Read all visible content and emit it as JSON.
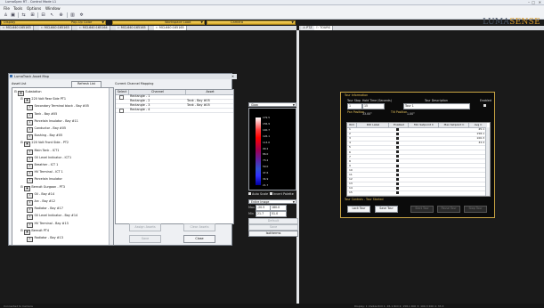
{
  "app": {
    "title": "LumaSpec RT - Control Mode L1",
    "window_controls": [
      "–",
      "□",
      "✕"
    ],
    "logo_main": "LUMA",
    "logo_accent": "SENSE",
    "logo_sub": "TECHNOLOGIES"
  },
  "menu": [
    "File",
    "Tools",
    "Options",
    "Window"
  ],
  "toolbar_icons": [
    "user-icon",
    "monitor-icon",
    "arrows-icon",
    "compare-icon",
    "grid-icon",
    "cursor-icon",
    "zoom-icon",
    "layout-icon",
    "settings-icon"
  ],
  "status_bars": {
    "left": {
      "label": "Display",
      "value": "Pop-Up Color"
    },
    "middle": {
      "label": "Workspace Load",
      "value": "Camera"
    }
  },
  "doc_tabs": [
    "MCL640:165163",
    "MCL640:165163",
    "MCL640:165164",
    "MCL640:165165",
    "MCL640:165165"
  ],
  "view_tabs": [
    "PTZ",
    "TOURS"
  ],
  "dialog": {
    "title": "LumaTrack Asset Map",
    "asset_list_label": "Asset List",
    "refresh_label": "Refresh List",
    "channel_mapping_label": "Current Channel Mapping",
    "tree": [
      {
        "level": 0,
        "label": "Substation"
      },
      {
        "level": 1,
        "label": "220 Volt Rear Side PT1"
      },
      {
        "level": 2,
        "label": "Secondary Terminal block - Bay #05"
      },
      {
        "level": 2,
        "label": "Tank - Bay #05"
      },
      {
        "level": 2,
        "label": "Porcelain Insulator - Bay #11"
      },
      {
        "level": 2,
        "label": "Conductor - Bay #05"
      },
      {
        "level": 2,
        "label": "Bushing - Bay #05"
      },
      {
        "level": 1,
        "label": "220 Volt Front Side - PT2"
      },
      {
        "level": 2,
        "label": "Main Tank - ICT1"
      },
      {
        "level": 2,
        "label": "Oil Level Indicator - ICT1"
      },
      {
        "level": 2,
        "label": "Breather - ICT 1"
      },
      {
        "level": 2,
        "label": "HV Terminal - ICT 1"
      },
      {
        "level": 2,
        "label": "Porcelain Insulator"
      },
      {
        "level": 1,
        "label": "Bernoit Gurgaon - PT3"
      },
      {
        "level": 2,
        "label": "Oil - Bay #14"
      },
      {
        "level": 2,
        "label": "Arc - Bay #12"
      },
      {
        "level": 2,
        "label": "Radiator - Bay #17"
      },
      {
        "level": 2,
        "label": "Oil Level Indicator - Bay #14"
      },
      {
        "level": 2,
        "label": "HV Terminal - Bay #13"
      },
      {
        "level": 1,
        "label": "Bernoit PT4"
      },
      {
        "level": 2,
        "label": "Radiator - Bay #13"
      }
    ],
    "grid_headers": [
      "Select",
      "Channel",
      "Asset"
    ],
    "grid_rows": [
      {
        "channel": "Rectangle - 1",
        "asset": ""
      },
      {
        "channel": "Rectangle - 2",
        "asset": "Tank - Bay #05"
      },
      {
        "channel": "Rectangle - 3",
        "asset": "Tank - Bay #05"
      },
      {
        "channel": "Rectangle - 4",
        "asset": ""
      }
    ],
    "assign_label": "Assign Assets",
    "clear_label": "Clear Assets",
    "save_label": "Save",
    "close_label": "Close"
  },
  "palette": {
    "select_value": "Glow",
    "ticks": [
      "179.5",
      "156.9",
      "140.7",
      "126.1",
      "113.0",
      "99.2",
      "86.0",
      "73.2",
      "59.0",
      "47.6",
      "34.9",
      "21.7"
    ],
    "auto_scale_label": "Auto Scale",
    "invert_label": "Invert Palette",
    "image_select": "Entire Image",
    "max_label": "Max",
    "max_vals": [
      "-20.5",
      "180.0"
    ],
    "min_label": "Min",
    "min_vals": [
      "21.7",
      "51.0"
    ],
    "buttons": [
      "Default",
      "Save",
      "Isotherms"
    ]
  },
  "tour": {
    "section_title": "Tour Information",
    "tour_stop_label": "Tour Stop",
    "hold_time_label": "Hold Time (Seconds)",
    "desc_label": "Tour Description",
    "enabled_label": "Enabled",
    "tour_stop_value": "1",
    "hold_time_value": "15",
    "desc_value": "Tour 1",
    "pan_label": "Pan Position",
    "pan_value": "33.00°",
    "tilt_label": "Tilt Position",
    "tilt_value": "1.00°",
    "grid_headers": [
      "ROI",
      "ROI Label",
      "Enabled",
      "Min Setpoint C",
      "Max Setpoint C",
      "Avg C"
    ],
    "grid_rows": [
      {
        "roi": "1",
        "avg": "45.1"
      },
      {
        "roi": "2",
        "avg": "158.1"
      },
      {
        "roi": "3",
        "avg": "100.3"
      },
      {
        "roi": "4",
        "avg": "33.3"
      },
      {
        "roi": "5",
        "avg": ""
      },
      {
        "roi": "6",
        "avg": ""
      },
      {
        "roi": "7",
        "avg": ""
      },
      {
        "roi": "8",
        "avg": ""
      },
      {
        "roi": "9",
        "avg": ""
      },
      {
        "roi": "10",
        "avg": ""
      },
      {
        "roi": "11",
        "avg": ""
      },
      {
        "roi": "12",
        "avg": ""
      },
      {
        "roi": "13",
        "avg": ""
      },
      {
        "roi": "14",
        "avg": ""
      },
      {
        "roi": "15",
        "avg": ""
      }
    ],
    "controls_label": "Tour Controls - Tour Started",
    "buttons": [
      "Lock Tour",
      "Save Tour",
      "Start Tour",
      "Pause Tour",
      "Stop Tour"
    ]
  },
  "statusbar": {
    "left": "Connected to Camera",
    "right": "Display: 1 Visible  ROI 1: 45.1   ROI 2: 158.1   ROI 3: 100.3   ROI 4: 33.3"
  },
  "colors": {
    "accent_yellow": "#d9a826",
    "tour_border": "#c9a544",
    "logo_accent": "#d79a2a"
  }
}
